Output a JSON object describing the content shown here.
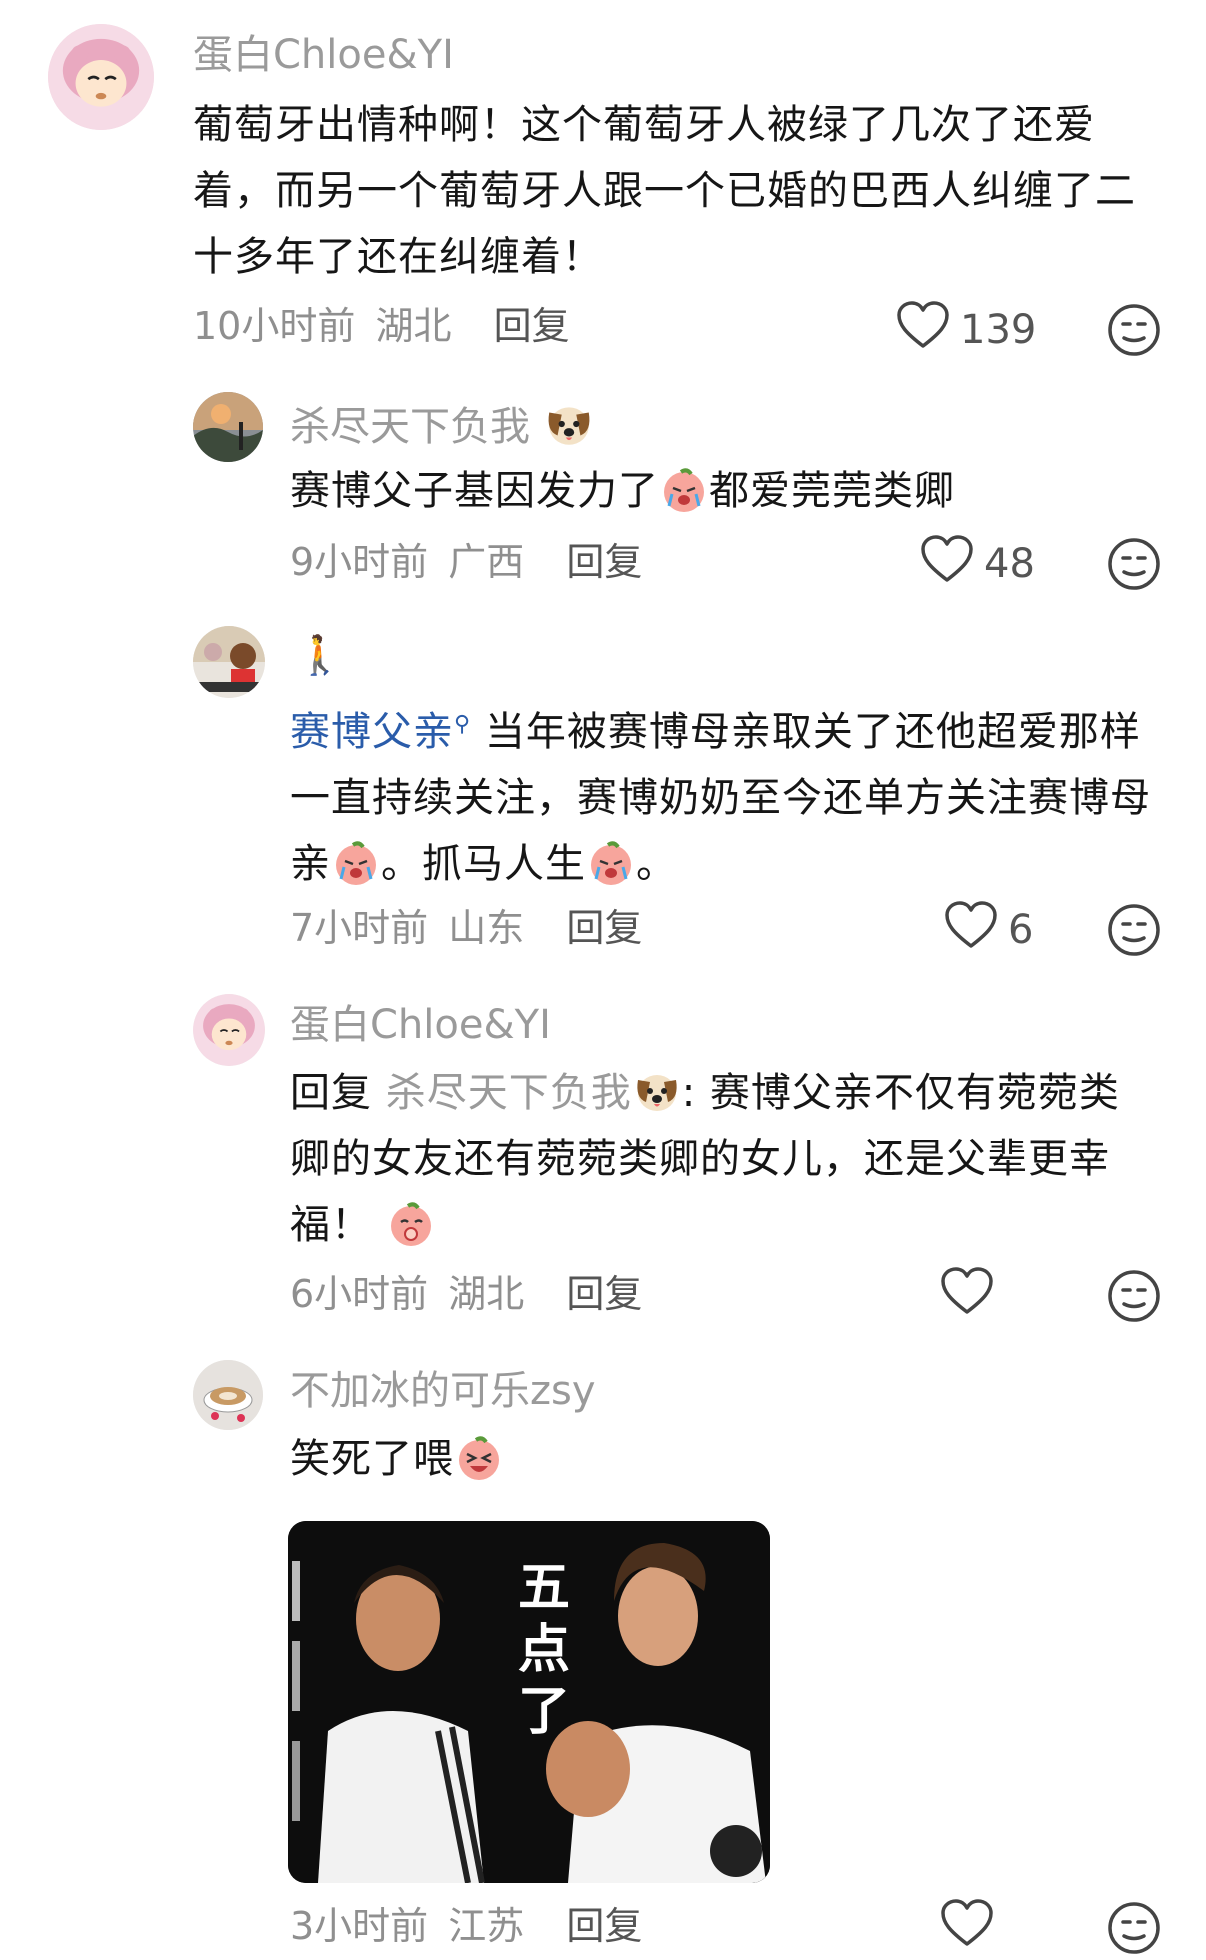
{
  "comments": [
    {
      "username": "蛋白Chloe&YI",
      "text_1": "葡萄牙出情种啊！这个葡萄牙人被绿了几次了还爱着，而另一个葡萄牙人跟一个已婚的巴西人纠缠了二十多年了还在纠缠着！",
      "time": "10小时前",
      "location": "湖北",
      "reply_label": "回复",
      "likes": "139"
    },
    {
      "username": "杀尽天下负我",
      "text_1": "赛博父子基因发力了",
      "text_2": "都爱莞莞类卿",
      "time": "9小时前",
      "location": "广西",
      "reply_label": "回复",
      "likes": "48"
    },
    {
      "username": "🚶",
      "mention": "赛博父亲",
      "text_1": " 当年被赛博母亲取关了还他超爱那样一直持续关注，赛博奶奶至今还单方关注赛博母亲",
      "text_2": "。抓马人生",
      "text_3": "。",
      "time": "7小时前",
      "location": "山东",
      "reply_label": "回复",
      "likes": "6"
    },
    {
      "username": "蛋白Chloe&YI",
      "reply_prefix": "回复 ",
      "reply_to": "杀尽天下负我",
      "text_1": ": 赛博父亲不仅有菀菀类卿的女友还有菀菀类卿的女儿，还是父辈更幸福！",
      "time": "6小时前",
      "location": "湖北",
      "reply_label": "回复",
      "likes": ""
    },
    {
      "username": "不加冰的可乐zsy",
      "text_1": "笑死了喂",
      "image_caption": "五点了",
      "time": "3小时前",
      "location": "江苏",
      "reply_label": "回复",
      "likes": ""
    }
  ],
  "colors": {
    "primary_text": "#161616",
    "secondary_text": "#9a9a9a",
    "mention": "#2a5caa"
  },
  "icons": {
    "like": "heart-outline-icon",
    "dislike": "meh-face-icon"
  }
}
